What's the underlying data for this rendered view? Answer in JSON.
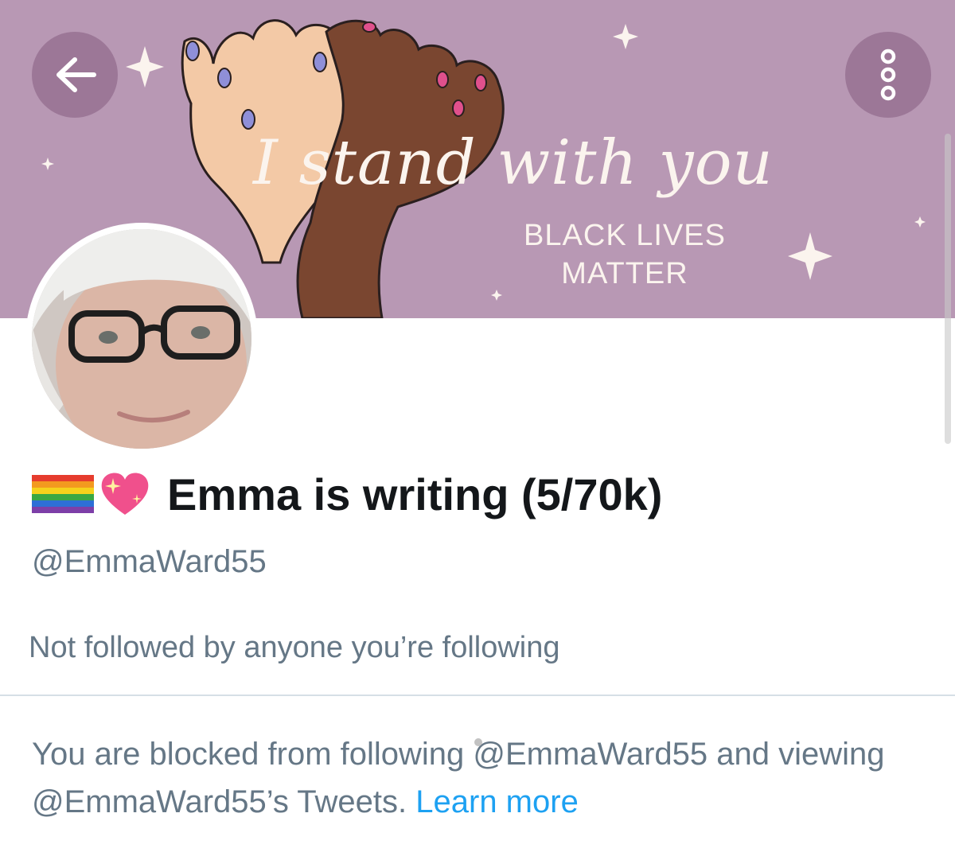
{
  "header": {
    "back_icon": "arrow-left-icon",
    "more_icon": "vertical-dots-icon",
    "banner": {
      "script_text": "I stand with you",
      "sub_line1": "BLACK LIVES",
      "sub_line2": "MATTER",
      "background_color": "#b898b4",
      "button_color": "#9c7797"
    }
  },
  "profile": {
    "name_emojis": [
      "rainbow-flag-emoji",
      "sparkling-heart-emoji"
    ],
    "display_name": "Emma is writing (5/70k)",
    "handle": "@EmmaWard55",
    "social_context": "Not followed by anyone you’re following"
  },
  "blocked_notice": {
    "text": "You are blocked from following @EmmaWard55 and viewing @EmmaWard55’s Tweets.",
    "link_label": "Learn more",
    "link_color": "#1da1f2"
  }
}
